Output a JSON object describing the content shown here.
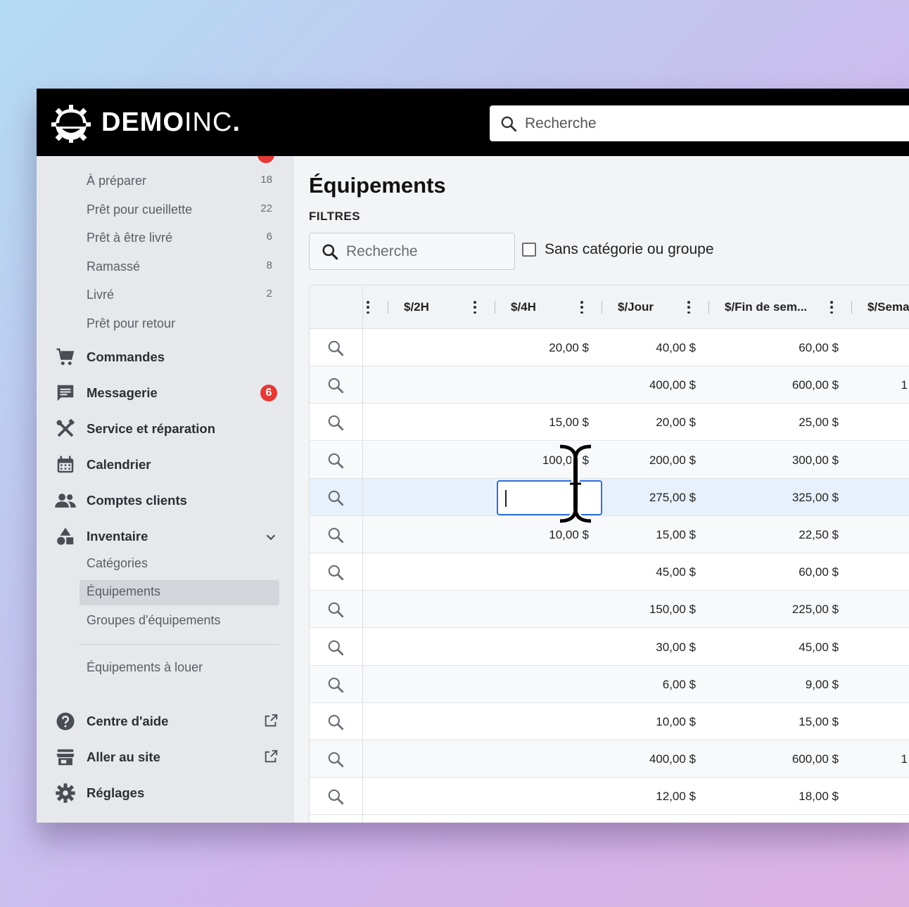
{
  "header": {
    "logo_main": "DEMO",
    "logo_thin": "INC",
    "logo_dot": ".",
    "search_placeholder": "Recherche"
  },
  "sidebar": {
    "sub_items": [
      {
        "label": "À préparer",
        "count": "18"
      },
      {
        "label": "Prêt pour cueillette",
        "count": "22"
      },
      {
        "label": "Prêt à être livré",
        "count": "6"
      },
      {
        "label": "Ramassé",
        "count": "8"
      },
      {
        "label": "Livré",
        "count": "2"
      },
      {
        "label": "Prêt pour retour",
        "count": ""
      }
    ],
    "nav": {
      "commandes": "Commandes",
      "messagerie": "Messagerie",
      "messagerie_badge": "6",
      "service": "Service et réparation",
      "calendrier": "Calendrier",
      "comptes": "Comptes clients",
      "inventaire": "Inventaire"
    },
    "inventory_sub": {
      "categories": "Catégories",
      "equipements": "Équipements",
      "groupes": "Groupes d'équipements",
      "a_louer": "Équipements à louer"
    },
    "bottom": {
      "aide": "Centre d'aide",
      "site": "Aller au site",
      "reglages": "Réglages"
    }
  },
  "main": {
    "title": "Équipements",
    "filters_label": "FILTRES",
    "search_placeholder": "Recherche",
    "checkbox_label": "Sans catégorie ou groupe",
    "columns": {
      "c2h": "$/2H",
      "c4h": "$/4H",
      "jour": "$/Jour",
      "fin": "$/Fin de sem...",
      "sem": "$/Sema"
    },
    "rows": [
      {
        "c4h": "20,00 $",
        "jour": "40,00 $",
        "fin": "60,00 $",
        "sem": ""
      },
      {
        "c4h": "",
        "jour": "400,00 $",
        "fin": "600,00 $",
        "sem": "1"
      },
      {
        "c4h": "15,00 $",
        "jour": "20,00 $",
        "fin": "25,00 $",
        "sem": ""
      },
      {
        "c4h": "100,00 $",
        "jour": "200,00 $",
        "fin": "300,00 $",
        "sem": ""
      },
      {
        "c4h": "",
        "jour": "275,00 $",
        "fin": "325,00 $",
        "sem": ""
      },
      {
        "c4h": "10,00 $",
        "jour": "15,00 $",
        "fin": "22,50 $",
        "sem": ""
      },
      {
        "c4h": "",
        "jour": "45,00 $",
        "fin": "60,00 $",
        "sem": ""
      },
      {
        "c4h": "",
        "jour": "150,00 $",
        "fin": "225,00 $",
        "sem": ""
      },
      {
        "c4h": "",
        "jour": "30,00 $",
        "fin": "45,00 $",
        "sem": ""
      },
      {
        "c4h": "",
        "jour": "6,00 $",
        "fin": "9,00 $",
        "sem": ""
      },
      {
        "c4h": "",
        "jour": "10,00 $",
        "fin": "15,00 $",
        "sem": ""
      },
      {
        "c4h": "",
        "jour": "400,00 $",
        "fin": "600,00 $",
        "sem": "1"
      },
      {
        "c4h": "",
        "jour": "12,00 $",
        "fin": "18,00 $",
        "sem": ""
      }
    ]
  },
  "colors": {
    "header_bg": "#000000",
    "badge": "#e53935",
    "edit_border": "#2f6fd8"
  }
}
